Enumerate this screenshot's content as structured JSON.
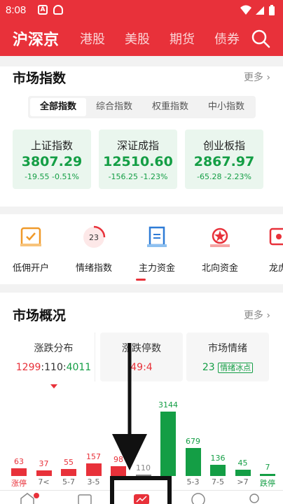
{
  "statusbar": {
    "time": "8:08",
    "icons": [
      "A",
      "shield"
    ]
  },
  "header": {
    "tabs": [
      "沪深京",
      "港股",
      "美股",
      "期货",
      "债券"
    ],
    "search_icon": "search-icon"
  },
  "market_index": {
    "title": "市场指数",
    "more": "更多",
    "seg_tabs": [
      "全部指数",
      "综合指数",
      "权重指数",
      "中小指数"
    ],
    "cards": [
      {
        "name": "上证指数",
        "value": "3807.29",
        "change": "-19.55  -0.51%"
      },
      {
        "name": "深证成指",
        "value": "12510.60",
        "change": "-156.25  -1.23%"
      },
      {
        "name": "创业板指",
        "value": "2867.97",
        "change": "-65.28  -2.23%"
      }
    ]
  },
  "quick_icons": [
    {
      "label": "低佣开户",
      "icon": "account-open-icon"
    },
    {
      "label": "情绪指数",
      "icon": "sentiment-icon",
      "badge": "23"
    },
    {
      "label": "主力资金",
      "icon": "capital-flow-icon"
    },
    {
      "label": "北向资金",
      "icon": "northbound-icon"
    },
    {
      "label": "龙虎",
      "icon": "dragon-tiger-icon"
    }
  ],
  "overview": {
    "title": "市场概况",
    "more": "更多",
    "tabs": [
      {
        "title": "涨跌分布",
        "value": "1299:110:4011"
      },
      {
        "title": "涨跌停数",
        "value": "49:4"
      },
      {
        "title": "市场情绪",
        "value": "23",
        "tag": "情绪冰点"
      }
    ]
  },
  "chart_data": {
    "type": "bar",
    "categories": [
      "涨停",
      "7<",
      "5-7",
      "3-5",
      "",
      "",
      "",
      "5-3",
      "7-5",
      ">7",
      "跌停"
    ],
    "values": [
      63,
      37,
      55,
      157,
      98,
      110,
      3144,
      679,
      136,
      45,
      7
    ],
    "value_labels": [
      "63",
      "37",
      "55",
      "157",
      "98",
      "110",
      "3144",
      "679",
      "136",
      "45",
      "7"
    ],
    "colors": [
      "#e8313a",
      "#e8313a",
      "#e8313a",
      "#e8313a",
      "#e8313a",
      "#888888",
      "#149e45",
      "#149e45",
      "#149e45",
      "#149e45",
      "#149e45"
    ]
  },
  "colors": {
    "brand": "#e8313a",
    "down": "#149e45",
    "up": "#e8313a"
  }
}
